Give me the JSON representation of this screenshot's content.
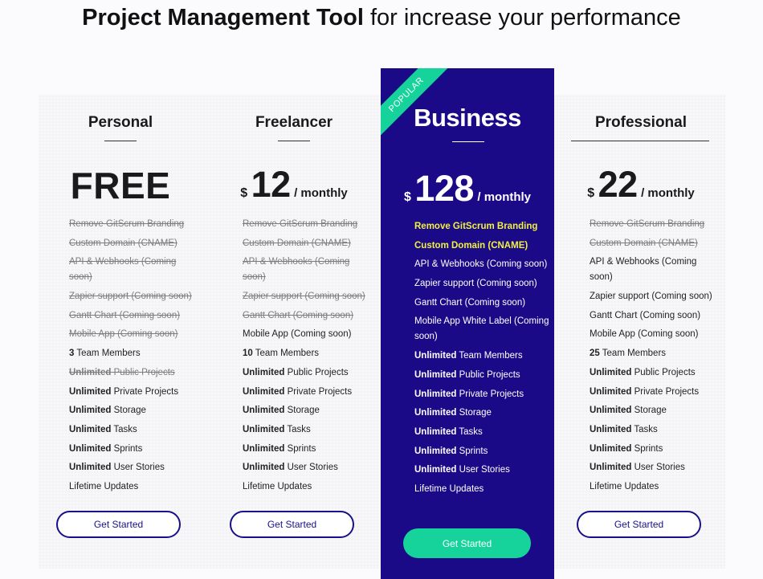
{
  "headline": {
    "bold": "Project Management Tool",
    "rest": " for increase your performance"
  },
  "colors": {
    "accent_navy": "#16108a",
    "business_bg": "#1a0a88",
    "ribbon_green": "#15d39a",
    "highlight_yellow": "#f2f23a"
  },
  "plans": {
    "personal": {
      "name": "Personal",
      "price_text": "FREE",
      "button": "Get Started",
      "features": [
        "Remove GitScrum Branding",
        "Custom Domain (CNAME)",
        "API & Webhooks (Coming soon)",
        "Zapier support (Coming soon)",
        "Gantt Chart (Coming soon)",
        "Mobile App (Coming soon)",
        {
          "bold": "3",
          "text": " Team Members"
        },
        {
          "bold": "Unlimited",
          "text": " Public Projects"
        },
        {
          "bold": "Unlimited",
          "text": " Private Projects"
        },
        {
          "bold": "Unlimited",
          "text": " Storage"
        },
        {
          "bold": "Unlimited",
          "text": " Tasks"
        },
        {
          "bold": "Unlimited",
          "text": " Sprints"
        },
        {
          "bold": "Unlimited",
          "text": " User Stories"
        },
        "Lifetime Updates"
      ]
    },
    "freelancer": {
      "name": "Freelancer",
      "currency": "$",
      "amount": "12",
      "period": "/ monthly",
      "button": "Get Started",
      "features": [
        "Remove GitScrum Branding",
        "Custom Domain (CNAME)",
        "API & Webhooks (Coming soon)",
        "Zapier support (Coming soon)",
        "Gantt Chart (Coming soon)",
        "Mobile App (Coming soon)",
        {
          "bold": "10",
          "text": " Team Members"
        },
        {
          "bold": "Unlimited",
          "text": " Public Projects"
        },
        {
          "bold": "Unlimited",
          "text": " Private Projects"
        },
        {
          "bold": "Unlimited",
          "text": " Storage"
        },
        {
          "bold": "Unlimited",
          "text": " Tasks"
        },
        {
          "bold": "Unlimited",
          "text": " Sprints"
        },
        {
          "bold": "Unlimited",
          "text": " User Stories"
        },
        "Lifetime Updates"
      ]
    },
    "business": {
      "ribbon": "POPULAR",
      "name": "Business",
      "currency": "$",
      "amount": "128",
      "period": "/ monthly",
      "button": "Get Started",
      "features": [
        "Remove GitScrum Branding",
        "Custom Domain (CNAME)",
        "API & Webhooks (Coming soon)",
        "Zapier support (Coming soon)",
        "Gantt Chart (Coming soon)",
        "Mobile App White Label (Coming soon)",
        {
          "bold": "Unlimited",
          "text": " Team Members"
        },
        {
          "bold": "Unlimited",
          "text": " Public Projects"
        },
        {
          "bold": "Unlimited",
          "text": " Private Projects"
        },
        {
          "bold": "Unlimited",
          "text": " Storage"
        },
        {
          "bold": "Unlimited",
          "text": " Tasks"
        },
        {
          "bold": "Unlimited",
          "text": " Sprints"
        },
        {
          "bold": "Unlimited",
          "text": " User Stories"
        },
        "Lifetime Updates"
      ]
    },
    "professional": {
      "name": "Professional",
      "currency": "$",
      "amount": "22",
      "period": "/ monthly",
      "button": "Get Started",
      "features": [
        "Remove GitScrum Branding",
        "Custom Domain (CNAME)",
        "API & Webhooks (Coming soon)",
        "Zapier support (Coming soon)",
        "Gantt Chart (Coming soon)",
        "Mobile App (Coming soon)",
        {
          "bold": "25",
          "text": " Team Members"
        },
        {
          "bold": "Unlimited",
          "text": " Public Projects"
        },
        {
          "bold": "Unlimited",
          "text": " Private Projects"
        },
        {
          "bold": "Unlimited",
          "text": " Storage"
        },
        {
          "bold": "Unlimited",
          "text": " Tasks"
        },
        {
          "bold": "Unlimited",
          "text": " Sprints"
        },
        {
          "bold": "Unlimited",
          "text": " User Stories"
        },
        "Lifetime Updates"
      ]
    }
  }
}
